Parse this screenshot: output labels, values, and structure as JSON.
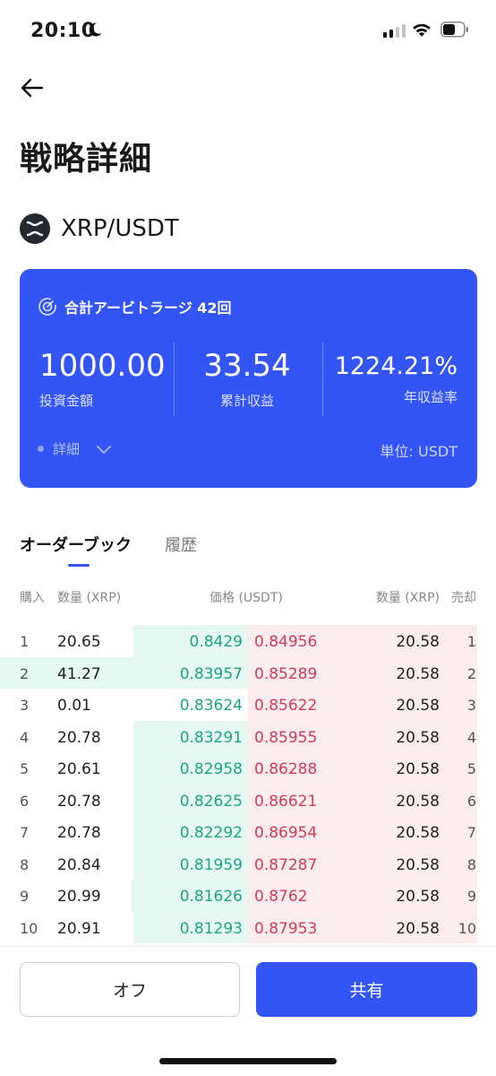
{
  "status_bar": {
    "time": "20:10"
  },
  "header": {
    "title": "戦略詳細"
  },
  "pair": {
    "name": "XRP/USDT"
  },
  "summary": {
    "headline": "合計アービトラージ 42回",
    "investment": {
      "value": "1000.00",
      "label": "投資金額"
    },
    "profit": {
      "value": "33.54",
      "label": "累計収益"
    },
    "apy": {
      "value": "1224.21%",
      "label": "年収益率"
    },
    "detail_label": "詳細",
    "unit_label": "単位: USDT"
  },
  "tabs": [
    {
      "label": "オーダーブック",
      "active": true
    },
    {
      "label": "履歴",
      "active": false
    }
  ],
  "orderbook": {
    "headers": {
      "buy": "購入",
      "buy_qty": "数量 (XRP)",
      "price": "価格 (USDT)",
      "sell_qty": "数量 (XRP)",
      "sell": "売却"
    },
    "rows": [
      {
        "n": "1",
        "bid_qty": "20.65",
        "bid_price": "0.8429",
        "ask_price": "0.84956",
        "ask_qty": "20.58",
        "n2": "1",
        "bid_depth": 0.5,
        "ask_depth": 1.0
      },
      {
        "n": "2",
        "bid_qty": "41.27",
        "bid_price": "0.83957",
        "ask_price": "0.85289",
        "ask_qty": "20.58",
        "n2": "2",
        "bid_depth": 1.0,
        "ask_depth": 1.0
      },
      {
        "n": "3",
        "bid_qty": "0.01",
        "bid_price": "0.83624",
        "ask_price": "0.85622",
        "ask_qty": "20.58",
        "n2": "3",
        "bid_depth": 0.0,
        "ask_depth": 1.0
      },
      {
        "n": "4",
        "bid_qty": "20.78",
        "bid_price": "0.83291",
        "ask_price": "0.85955",
        "ask_qty": "20.58",
        "n2": "4",
        "bid_depth": 0.5,
        "ask_depth": 1.0
      },
      {
        "n": "5",
        "bid_qty": "20.61",
        "bid_price": "0.82958",
        "ask_price": "0.86288",
        "ask_qty": "20.58",
        "n2": "5",
        "bid_depth": 0.5,
        "ask_depth": 1.0
      },
      {
        "n": "6",
        "bid_qty": "20.78",
        "bid_price": "0.82625",
        "ask_price": "0.86621",
        "ask_qty": "20.58",
        "n2": "6",
        "bid_depth": 0.5,
        "ask_depth": 1.0
      },
      {
        "n": "7",
        "bid_qty": "20.78",
        "bid_price": "0.82292",
        "ask_price": "0.86954",
        "ask_qty": "20.58",
        "n2": "7",
        "bid_depth": 0.5,
        "ask_depth": 1.0
      },
      {
        "n": "8",
        "bid_qty": "20.84",
        "bid_price": "0.81959",
        "ask_price": "0.87287",
        "ask_qty": "20.58",
        "n2": "8",
        "bid_depth": 0.5,
        "ask_depth": 1.0
      },
      {
        "n": "9",
        "bid_qty": "20.99",
        "bid_price": "0.81626",
        "ask_price": "0.8762",
        "ask_qty": "20.58",
        "n2": "9",
        "bid_depth": 0.51,
        "ask_depth": 1.0
      },
      {
        "n": "10",
        "bid_qty": "20.91",
        "bid_price": "0.81293",
        "ask_price": "0.87953",
        "ask_qty": "20.58",
        "n2": "10",
        "bid_depth": 0.5,
        "ask_depth": 1.0
      }
    ]
  },
  "actions": {
    "off_label": "オフ",
    "share_label": "共有"
  },
  "colors": {
    "accent": "#3355f5",
    "bid": "#19a87e",
    "ask": "#d33a54",
    "bid_bg": "#e7f7f2",
    "ask_bg": "#fbecee"
  }
}
